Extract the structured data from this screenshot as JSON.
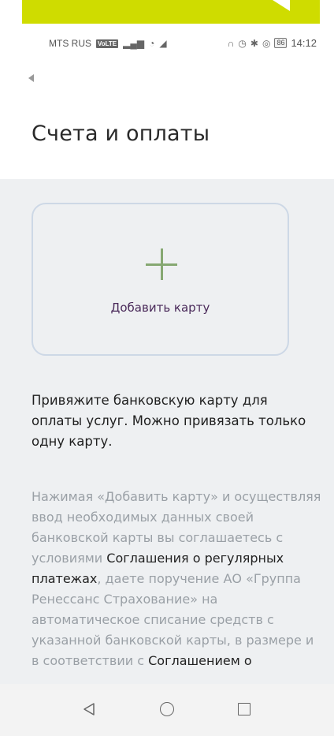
{
  "status_bar": {
    "carrier": "MTS RUS",
    "volte": "VoLTE",
    "battery": "86",
    "time": "14:12"
  },
  "header": {
    "title": "Счета и оплаты"
  },
  "add_card": {
    "label": "Добавить карту"
  },
  "info": {
    "lead": "Привяжите банковскую карту для оплаты услуг. Можно привязать только одну карту.",
    "legal_part1": "Нажимая «Добавить карту» и осуществляя ввод необходимых данных своей банковской карты вы соглашаетесь с условиями ",
    "legal_link1": "Соглашения о регулярных платежах",
    "legal_part2": ", даете поручение АО «Группа Ренессанс Страхование» на автоматическое списание средств с указанной банковской карты, в размере и в соответствии с ",
    "legal_link2": "Соглашением о"
  },
  "colors": {
    "banner": "#cfdc00",
    "plus": "#86a872",
    "add_label": "#4a2a5a",
    "card_border": "#cdd8e6",
    "content_bg": "#eef0f2"
  }
}
